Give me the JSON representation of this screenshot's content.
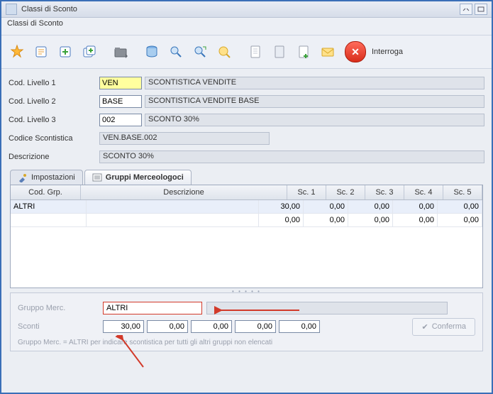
{
  "window": {
    "title": "Classi di Sconto",
    "subtitle": "Classi di Sconto"
  },
  "mode_label": "Interroga",
  "toolbar_icons": [
    "star",
    "edit",
    "add",
    "add-multi",
    "sep",
    "folder",
    "sep",
    "db",
    "find",
    "find-next",
    "zoom",
    "sep",
    "doc-new",
    "doc",
    "doc-add",
    "mail"
  ],
  "levels": {
    "l1_label": "Cod. Livello 1",
    "l1_val": "VEN",
    "l1_desc": "SCONTISTICA VENDITE",
    "l2_label": "Cod. Livello 2",
    "l2_val": "BASE",
    "l2_desc": "SCONTISTICA VENDITE BASE",
    "l3_label": "Cod. Livello 3",
    "l3_val": "002",
    "l3_desc": "SCONTO 30%",
    "code_label": "Codice Scontistica",
    "code_val": "VEN.BASE.002",
    "desc_label": "Descrizione",
    "desc_val": "SCONTO 30%"
  },
  "tabs": {
    "t1": "Impostazioni",
    "t2": "Gruppi Merceologoci"
  },
  "grid": {
    "h_grp": "Cod. Grp.",
    "h_desc": "Descrizione",
    "h_sc1": "Sc. 1",
    "h_sc2": "Sc. 2",
    "h_sc3": "Sc. 3",
    "h_sc4": "Sc. 4",
    "h_sc5": "Sc. 5",
    "rows": [
      {
        "grp": "ALTRI",
        "desc": "",
        "sc1": "30,00",
        "sc2": "0,00",
        "sc3": "0,00",
        "sc4": "0,00",
        "sc5": "0,00"
      },
      {
        "grp": "",
        "desc": "",
        "sc1": "0,00",
        "sc2": "0,00",
        "sc3": "0,00",
        "sc4": "0,00",
        "sc5": "0,00"
      }
    ]
  },
  "detail": {
    "grp_label": "Gruppo Merc.",
    "grp_val": "ALTRI",
    "sc_label": "Sconti",
    "sc1": "30,00",
    "sc2": "0,00",
    "sc3": "0,00",
    "sc4": "0,00",
    "sc5": "0,00",
    "confirm": "Conferma",
    "hint": "Gruppo Merc. = ALTRI per indicare scontistica per tutti gli altri gruppi non elencati"
  }
}
